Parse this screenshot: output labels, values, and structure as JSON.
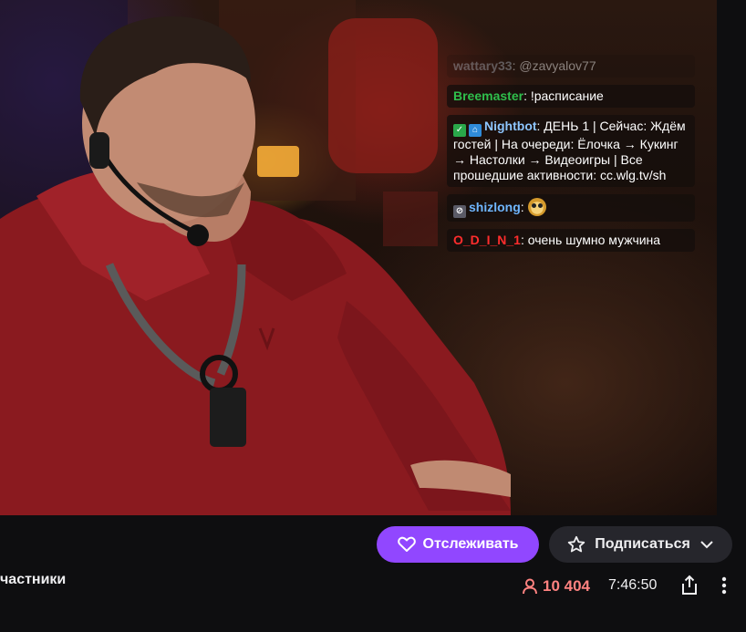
{
  "chat": {
    "messages": [
      {
        "name": "wattary33",
        "text": ": @zavyalov77",
        "color": "#9fa9b4",
        "faded": true
      },
      {
        "name": "Breemaster",
        "text": ": !расписание",
        "color": "#2fbf4c"
      },
      {
        "name": "Nightbot",
        "text": ": ДЕНЬ 1 | Сейчас: Ждём гостей | На очереди: Ёлочка → Кукинг → Настолки → Видеоигры | Все прошедшие активности: cc.wlg.tv/sh",
        "color": "#8ec6ff",
        "badges": [
          "check",
          "bot"
        ]
      },
      {
        "name": "shizlong",
        "text": ":",
        "color": "#6fb6ff",
        "badges": [
          "crossed"
        ],
        "emote": "owl-emote"
      },
      {
        "name": "O_D_I_N_1",
        "text": ": очень шумно мужчина",
        "color": "#ff2d2d"
      }
    ]
  },
  "actions": {
    "follow_label": "Отслеживать",
    "subscribe_label": "Подписаться"
  },
  "stream": {
    "category_partial": "частники",
    "viewers": "10 404",
    "uptime": "7:46:50"
  },
  "colors": {
    "accent": "#9147ff",
    "live_red": "#ff8280",
    "bar_bg": "#0e0e10"
  },
  "icons": [
    "heart-icon",
    "star-icon",
    "chevron-down-icon",
    "viewers-icon",
    "share-icon",
    "more-icon"
  ]
}
